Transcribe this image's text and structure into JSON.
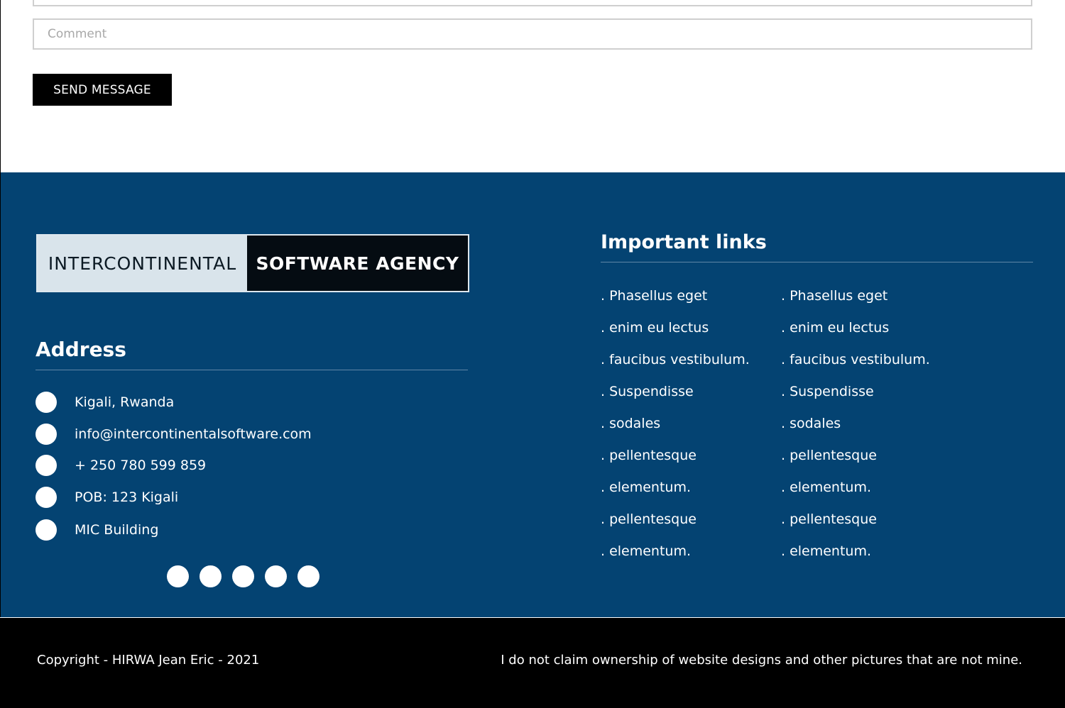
{
  "form": {
    "comment_placeholder": "Comment",
    "send_label": "SEND MESSAGE"
  },
  "footer": {
    "logo": {
      "left_text": "INTERCONTINENTAL",
      "right_text": "SOFTWARE AGENCY"
    },
    "address": {
      "title": "Address",
      "items": [
        {
          "icon": "location-icon",
          "text": "Kigali, Rwanda"
        },
        {
          "icon": "email-icon",
          "text": "info@intercontinentalsoftware.com"
        },
        {
          "icon": "phone-icon",
          "text": "+ 250 780 599 859"
        },
        {
          "icon": "mailbox-icon",
          "text": "POB: 123 Kigali"
        },
        {
          "icon": "building-icon",
          "text": "MIC Building"
        }
      ]
    },
    "socials": [
      "facebook-icon",
      "twitter-icon",
      "instagram-icon",
      "linkedin-icon",
      "youtube-icon"
    ],
    "links": {
      "title": "Important links",
      "column_1": [
        ". Phasellus eget",
        ". enim eu lectus",
        ". faucibus vestibulum.",
        ". Suspendisse",
        ". sodales",
        ". pellentesque",
        ". elementum.",
        ". pellentesque",
        ". elementum."
      ],
      "column_2": [
        ". Phasellus eget",
        ". enim eu lectus",
        ". faucibus vestibulum.",
        ". Suspendisse",
        ". sodales",
        ". pellentesque",
        ". elementum.",
        ". pellentesque",
        ". elementum."
      ]
    }
  },
  "bottom": {
    "copyright": "Copyright - HIRWA Jean Eric - 2021",
    "disclaimer": "I do not claim ownership of website designs and other pictures that are not mine."
  },
  "colors": {
    "footer_bg": "#044372",
    "bottom_bg": "#000000",
    "logo_light": "#d9e4eb",
    "logo_dark": "#050c12"
  }
}
